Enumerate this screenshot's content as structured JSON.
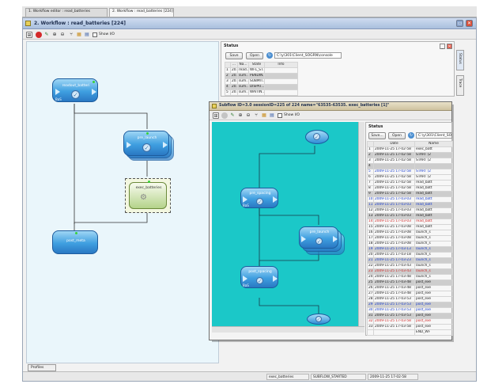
{
  "tabs": [
    {
      "label": "1. Workflow editor : read_batteries"
    },
    {
      "label": "2. Workflow : read_batteries [224]"
    }
  ],
  "main_window": {
    "title": "2. Workflow : read_batteries [224]",
    "show_io_label": "Show I/O"
  },
  "workflow_nodes": [
    {
      "label": "readout_batteri",
      "sub": "BaS"
    },
    {
      "label": "pre_launch",
      "sub": ""
    },
    {
      "label": "exec_batteries",
      "sub": ""
    },
    {
      "label": "post_meta",
      "sub": "BaS"
    }
  ],
  "status_panel": {
    "title": "Status",
    "save_label": "Save",
    "open_label": "Open",
    "path": "C:\\y\\301\\Client_SOGRN\\console",
    "columns": [
      "",
      "...",
      "Na...",
      "State",
      "Info"
    ],
    "rows": [
      [
        "1",
        "20...",
        "read...",
        "WFL_ST..."
      ],
      [
        "2",
        "20...",
        "sum...",
        "PENDIN..."
      ],
      [
        "3",
        "20...",
        "sum...",
        "SUBMIT..."
      ],
      [
        "4",
        "20...",
        "sum...",
        "DISPAT..."
      ],
      [
        "5",
        "20...",
        "sum...",
        "WAITIN..."
      ]
    ],
    "side_tabs": [
      "Status",
      "Trace"
    ]
  },
  "subflow": {
    "title": "Subflow ID=3.0 sessionID=225 of 224 name=\"63535-63535. exec_batteries [1]\"",
    "show_io_label": "Show I/O",
    "nodes": [
      {
        "label": "pre_spacing",
        "sub": "BaS"
      },
      {
        "label": "pre_launch",
        "sub": ""
      },
      {
        "label": "post_spacing",
        "sub": "BaS"
      }
    ],
    "status": {
      "title": "Status",
      "save_label": "Save...",
      "open_label": "Open",
      "path": "C:\\y\\301\\Client_SOG",
      "columns": [
        "",
        "Date",
        "Name"
      ],
      "rows": [
        [
          "1",
          "2009-11-25 17-02-58",
          "exec_batt"
        ],
        [
          "2",
          "2009-11-25 17-02-58",
          "START (2"
        ],
        [
          "3",
          "2009-11-25 17-02-58",
          "START (2"
        ],
        [
          "4",
          "",
          ""
        ],
        [
          "5",
          "2009-11-25 17-02-58",
          "START (2"
        ],
        [
          "6",
          "2009-11-25 17-02-58",
          "START (2"
        ],
        [
          "7",
          "2009-11-25 17-02-58",
          "read_batt"
        ],
        [
          "8",
          "2009-11-25 17-02-58",
          "read_batt"
        ],
        [
          "9",
          "2009-11-25 17-02-58",
          "read_batt"
        ],
        [
          "10",
          "2009-11-25 17-03-03",
          "read_batt"
        ],
        [
          "11",
          "2009-11-25 17-03-03",
          "read_batt"
        ],
        [
          "12",
          "2009-11-25 17-03-03",
          "read_batt"
        ],
        [
          "13",
          "2009-11-25 17-03-03",
          "read_batt"
        ],
        [
          "14",
          "2009-11-25 17-03-03",
          "read_batt"
        ],
        [
          "15",
          "2009-11-25 17-03-08",
          "read_batt"
        ],
        [
          "16",
          "2009-11-25 17-03-08",
          "launch_s"
        ],
        [
          "17",
          "2009-11-25 17-03-08",
          "launch_s"
        ],
        [
          "18",
          "2009-11-25 17-03-08",
          "launch_s"
        ],
        [
          "19",
          "2009-11-25 17-03-13",
          "launch_s"
        ],
        [
          "20",
          "2009-11-25 17-03-18",
          "launch_s"
        ],
        [
          "21",
          "2009-11-25 17-03-23",
          "launch_s"
        ],
        [
          "22",
          "2009-11-25 17-03-43",
          "launch_s"
        ],
        [
          "23",
          "2009-11-25 17-03-43",
          "launch_s"
        ],
        [
          "24",
          "2009-11-25 17-03-48",
          "launch_s"
        ],
        [
          "25",
          "2009-11-25 17-03-48",
          "post_exe"
        ],
        [
          "26",
          "2009-11-25 17-03-48",
          "post_exe"
        ],
        [
          "27",
          "2009-11-25 17-03-48",
          "post_exe"
        ],
        [
          "28",
          "2009-11-25 17-03-53",
          "post_exe"
        ],
        [
          "29",
          "2009-11-25 17-03-53",
          "post_exe"
        ],
        [
          "30",
          "2009-11-25 17-03-53",
          "post_exe"
        ],
        [
          "31",
          "2009-11-25 17-03-53",
          "post_exe"
        ],
        [
          "32",
          "2009-11-25 17-03-58",
          "post_exe"
        ],
        [
          "33",
          "2009-11-25 17-03-58",
          "post_exe"
        ]
      ],
      "bottom": "END_WF"
    }
  },
  "profiles_label": "Profiles",
  "statusbar": {
    "name": "exec_batteries",
    "state": "SUBFLOW_STARTED",
    "time": "2009-11-25 17-02-58"
  },
  "colors": {
    "cyan_canvas": "#1bc8c8",
    "light_canvas": "#eaf6fb",
    "node_blue": "#3f9fe0"
  }
}
